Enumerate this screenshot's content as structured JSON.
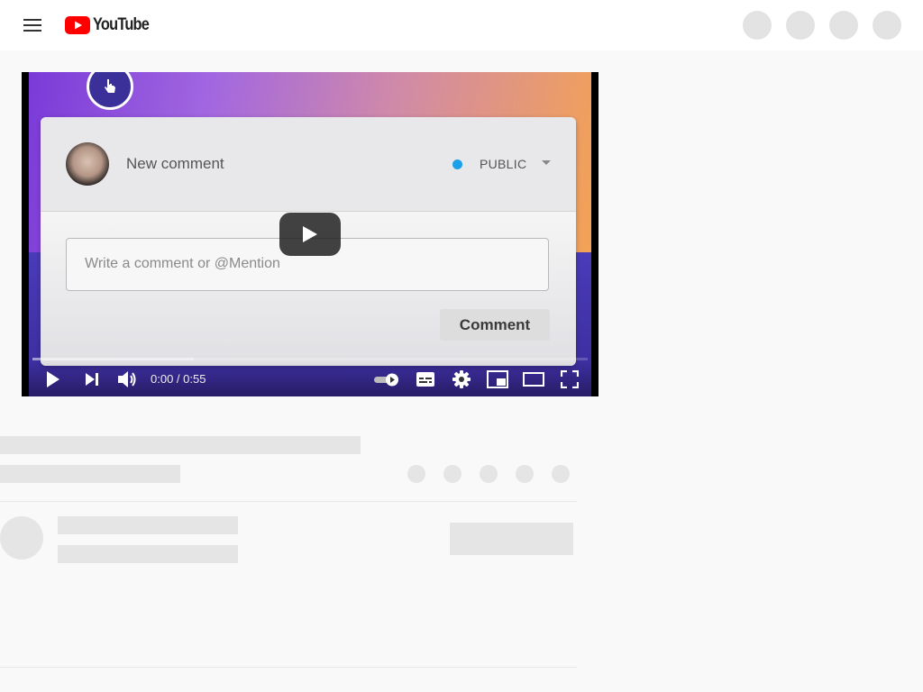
{
  "header": {
    "brand": "YouTube",
    "brand_color": "#ff0000",
    "menu_icon": "hamburger-menu-icon"
  },
  "video": {
    "frame": {
      "card_title": "New comment",
      "visibility_label": "PUBLIC",
      "visibility_dot_color": "#1aa0e8",
      "input_placeholder": "Write a comment or @Mention",
      "submit_label": "Comment"
    },
    "player": {
      "time_display": "0:00 / 0:55",
      "progress_loaded_fraction": 0.29,
      "controls": [
        "play-icon",
        "next-icon",
        "volume-icon",
        "autoplay-toggle-icon",
        "subtitles-icon",
        "settings-icon",
        "miniplayer-icon",
        "theater-mode-icon",
        "fullscreen-icon"
      ]
    }
  }
}
